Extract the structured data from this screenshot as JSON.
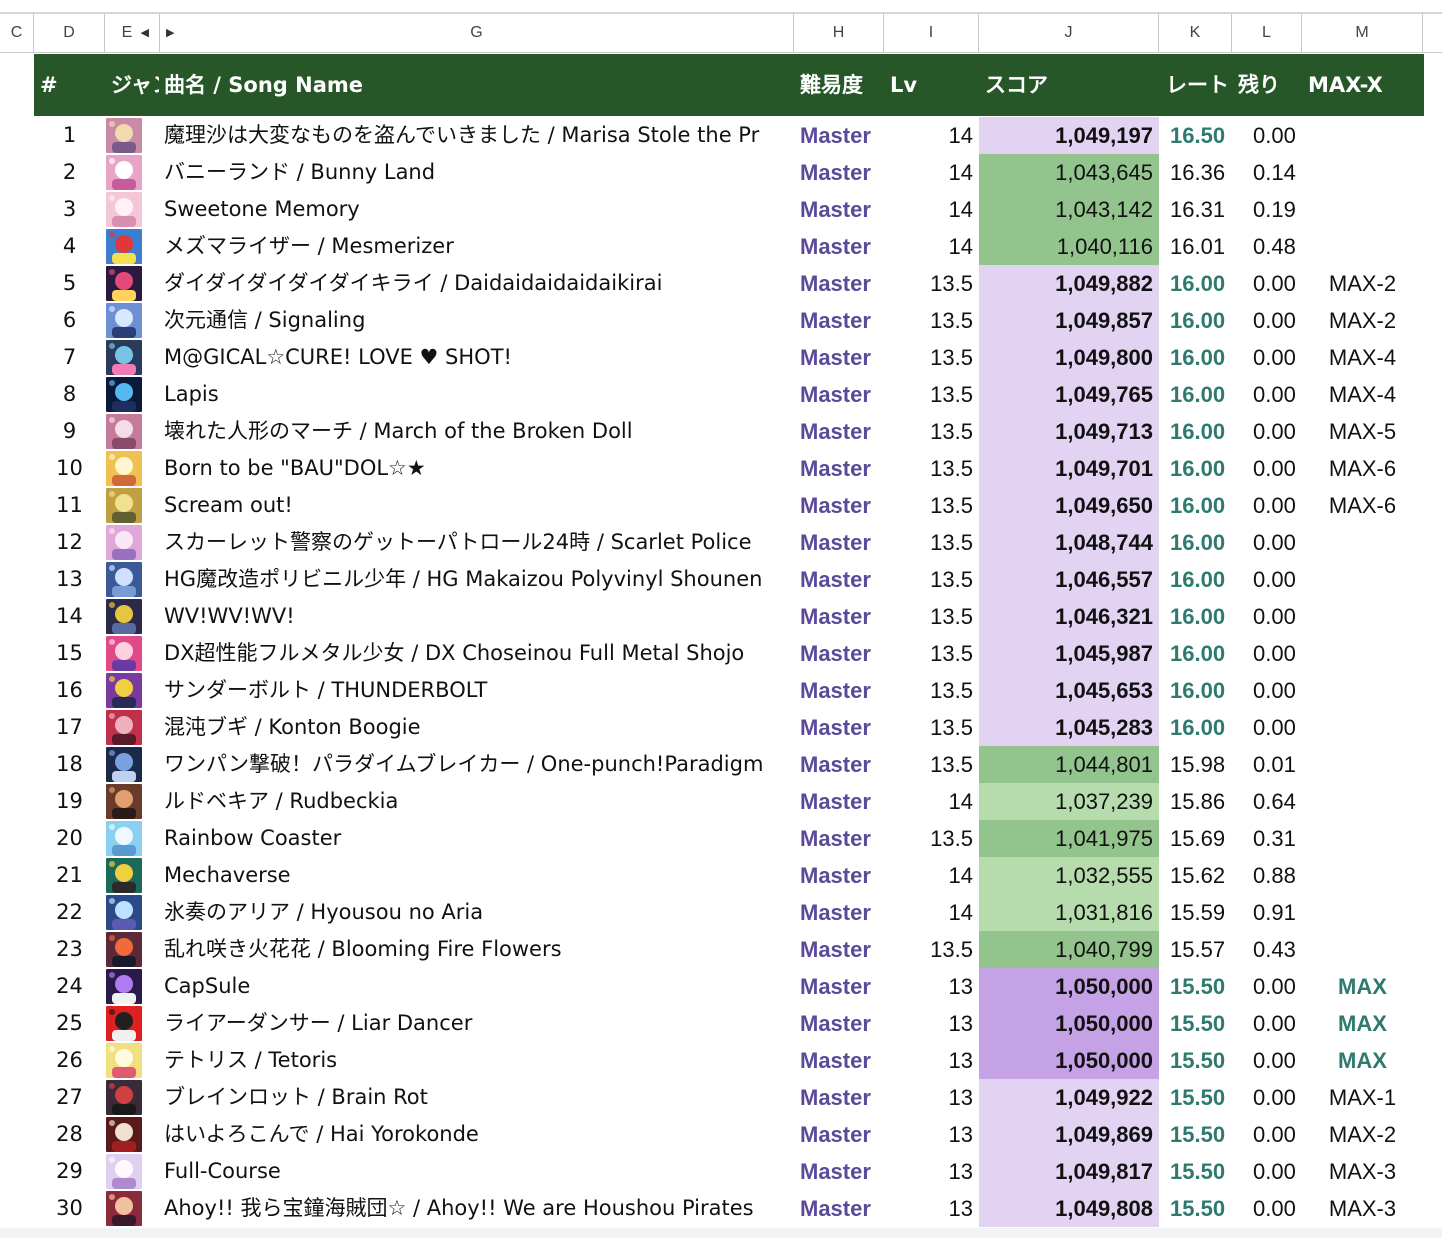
{
  "column_headers": [
    "C",
    "D",
    "E",
    "G",
    "H",
    "I",
    "J",
    "K",
    "L",
    "M"
  ],
  "header": {
    "num": "#",
    "genre": "ジャンル",
    "song": "曲名 / Song Name",
    "difficulty": "難易度",
    "lv": "Lv",
    "score": "スコア",
    "rate": "レート",
    "remaining": "残り",
    "maxx": "MAX-X"
  },
  "colors": {
    "header_bg": "#275729",
    "score_purple": "#e2d3f3",
    "score_purple_max": "#c5a2e6",
    "score_green": "#94c48d",
    "score_green_light": "#b6dcad",
    "difficulty_text": "#5b4a9a",
    "rate_teal": "#2e7a6e"
  },
  "rows": [
    {
      "n": "1",
      "song": "魔理沙は大変なものを盗んでいきました / Marisa Stole the Pr",
      "diff": "Master",
      "lv": "14",
      "score": "1,049,197",
      "rate": "16.50",
      "rem": "0.00",
      "maxx": "",
      "bg": "purple",
      "bold": true,
      "top": true
    },
    {
      "n": "2",
      "song": "バニーランド / Bunny Land",
      "diff": "Master",
      "lv": "14",
      "score": "1,043,645",
      "rate": "16.36",
      "rem": "0.14",
      "maxx": "",
      "bg": "green",
      "bold": false,
      "top": false
    },
    {
      "n": "3",
      "song": "Sweetone Memory",
      "diff": "Master",
      "lv": "14",
      "score": "1,043,142",
      "rate": "16.31",
      "rem": "0.19",
      "maxx": "",
      "bg": "green",
      "bold": false,
      "top": false
    },
    {
      "n": "4",
      "song": "メズマライザー / Mesmerizer",
      "diff": "Master",
      "lv": "14",
      "score": "1,040,116",
      "rate": "16.01",
      "rem": "0.48",
      "maxx": "",
      "bg": "green",
      "bold": false,
      "top": false
    },
    {
      "n": "5",
      "song": "ダイダイダイダイダイキライ / Daidaidaidaidaikirai",
      "diff": "Master",
      "lv": "13.5",
      "score": "1,049,882",
      "rate": "16.00",
      "rem": "0.00",
      "maxx": "MAX-2",
      "bg": "purple",
      "bold": true,
      "top": true
    },
    {
      "n": "6",
      "song": "次元通信 / Signaling",
      "diff": "Master",
      "lv": "13.5",
      "score": "1,049,857",
      "rate": "16.00",
      "rem": "0.00",
      "maxx": "MAX-2",
      "bg": "purple",
      "bold": true,
      "top": true
    },
    {
      "n": "7",
      "song": "M@GICAL☆CURE! LOVE ♥ SHOT!",
      "diff": "Master",
      "lv": "13.5",
      "score": "1,049,800",
      "rate": "16.00",
      "rem": "0.00",
      "maxx": "MAX-4",
      "bg": "purple",
      "bold": true,
      "top": true
    },
    {
      "n": "8",
      "song": "Lapis",
      "diff": "Master",
      "lv": "13.5",
      "score": "1,049,765",
      "rate": "16.00",
      "rem": "0.00",
      "maxx": "MAX-4",
      "bg": "purple",
      "bold": true,
      "top": true
    },
    {
      "n": "9",
      "song": "壊れた人形のマーチ / March of the Broken Doll",
      "diff": "Master",
      "lv": "13.5",
      "score": "1,049,713",
      "rate": "16.00",
      "rem": "0.00",
      "maxx": "MAX-5",
      "bg": "purple",
      "bold": true,
      "top": true
    },
    {
      "n": "10",
      "song": "Born to be \"BAU\"DOL☆★",
      "diff": "Master",
      "lv": "13.5",
      "score": "1,049,701",
      "rate": "16.00",
      "rem": "0.00",
      "maxx": "MAX-6",
      "bg": "purple",
      "bold": true,
      "top": true
    },
    {
      "n": "11",
      "song": "Scream out!",
      "diff": "Master",
      "lv": "13.5",
      "score": "1,049,650",
      "rate": "16.00",
      "rem": "0.00",
      "maxx": "MAX-6",
      "bg": "purple",
      "bold": true,
      "top": true
    },
    {
      "n": "12",
      "song": "スカーレット警察のゲットーパトロール24時 / Scarlet Police",
      "diff": "Master",
      "lv": "13.5",
      "score": "1,048,744",
      "rate": "16.00",
      "rem": "0.00",
      "maxx": "",
      "bg": "purple",
      "bold": true,
      "top": true
    },
    {
      "n": "13",
      "song": "HG魔改造ポリビニル少年 / HG Makaizou Polyvinyl Shounen",
      "diff": "Master",
      "lv": "13.5",
      "score": "1,046,557",
      "rate": "16.00",
      "rem": "0.00",
      "maxx": "",
      "bg": "purple",
      "bold": true,
      "top": true
    },
    {
      "n": "14",
      "song": "WV!WV!WV!",
      "diff": "Master",
      "lv": "13.5",
      "score": "1,046,321",
      "rate": "16.00",
      "rem": "0.00",
      "maxx": "",
      "bg": "purple",
      "bold": true,
      "top": true
    },
    {
      "n": "15",
      "song": "DX超性能フルメタル少女 / DX Choseinou Full Metal Shojo",
      "diff": "Master",
      "lv": "13.5",
      "score": "1,045,987",
      "rate": "16.00",
      "rem": "0.00",
      "maxx": "",
      "bg": "purple",
      "bold": true,
      "top": true
    },
    {
      "n": "16",
      "song": "サンダーボルト / THUNDERBOLT",
      "diff": "Master",
      "lv": "13.5",
      "score": "1,045,653",
      "rate": "16.00",
      "rem": "0.00",
      "maxx": "",
      "bg": "purple",
      "bold": true,
      "top": true
    },
    {
      "n": "17",
      "song": "混沌ブギ / Konton Boogie",
      "diff": "Master",
      "lv": "13.5",
      "score": "1,045,283",
      "rate": "16.00",
      "rem": "0.00",
      "maxx": "",
      "bg": "purple",
      "bold": true,
      "top": true
    },
    {
      "n": "18",
      "song": "ワンパン撃破！パラダイムブレイカー / One-punch!Paradigm",
      "diff": "Master",
      "lv": "13.5",
      "score": "1,044,801",
      "rate": "15.98",
      "rem": "0.01",
      "maxx": "",
      "bg": "green",
      "bold": false,
      "top": false
    },
    {
      "n": "19",
      "song": "ルドベキア / Rudbeckia",
      "diff": "Master",
      "lv": "14",
      "score": "1,037,239",
      "rate": "15.86",
      "rem": "0.64",
      "maxx": "",
      "bg": "greenlight",
      "bold": false,
      "top": false
    },
    {
      "n": "20",
      "song": "Rainbow Coaster",
      "diff": "Master",
      "lv": "13.5",
      "score": "1,041,975",
      "rate": "15.69",
      "rem": "0.31",
      "maxx": "",
      "bg": "green",
      "bold": false,
      "top": false
    },
    {
      "n": "21",
      "song": "Mechaverse",
      "diff": "Master",
      "lv": "14",
      "score": "1,032,555",
      "rate": "15.62",
      "rem": "0.88",
      "maxx": "",
      "bg": "greenlight",
      "bold": false,
      "top": false
    },
    {
      "n": "22",
      "song": "氷奏のアリア / Hyousou no Aria",
      "diff": "Master",
      "lv": "14",
      "score": "1,031,816",
      "rate": "15.59",
      "rem": "0.91",
      "maxx": "",
      "bg": "greenlight",
      "bold": false,
      "top": false
    },
    {
      "n": "23",
      "song": "乱れ咲き火花花 / Blooming Fire Flowers",
      "diff": "Master",
      "lv": "13.5",
      "score": "1,040,799",
      "rate": "15.57",
      "rem": "0.43",
      "maxx": "",
      "bg": "green",
      "bold": false,
      "top": false
    },
    {
      "n": "24",
      "song": "CapSule",
      "diff": "Master",
      "lv": "13",
      "score": "1,050,000",
      "rate": "15.50",
      "rem": "0.00",
      "maxx": "MAX",
      "bg": "purplemax",
      "bold": true,
      "top": true
    },
    {
      "n": "25",
      "song": "ライアーダンサー / Liar Dancer",
      "diff": "Master",
      "lv": "13",
      "score": "1,050,000",
      "rate": "15.50",
      "rem": "0.00",
      "maxx": "MAX",
      "bg": "purplemax",
      "bold": true,
      "top": true
    },
    {
      "n": "26",
      "song": "テトリス / Tetoris",
      "diff": "Master",
      "lv": "13",
      "score": "1,050,000",
      "rate": "15.50",
      "rem": "0.00",
      "maxx": "MAX",
      "bg": "purplemax",
      "bold": true,
      "top": true
    },
    {
      "n": "27",
      "song": "ブレインロット / Brain Rot",
      "diff": "Master",
      "lv": "13",
      "score": "1,049,922",
      "rate": "15.50",
      "rem": "0.00",
      "maxx": "MAX-1",
      "bg": "purple",
      "bold": true,
      "top": true
    },
    {
      "n": "28",
      "song": "はいよろこんで / Hai Yorokonde",
      "diff": "Master",
      "lv": "13",
      "score": "1,049,869",
      "rate": "15.50",
      "rem": "0.00",
      "maxx": "MAX-2",
      "bg": "purple",
      "bold": true,
      "top": true
    },
    {
      "n": "29",
      "song": "Full-Course",
      "diff": "Master",
      "lv": "13",
      "score": "1,049,817",
      "rate": "15.50",
      "rem": "0.00",
      "maxx": "MAX-3",
      "bg": "purple",
      "bold": true,
      "top": true
    },
    {
      "n": "30",
      "song": "Ahoy!! 我ら宝鐘海賊団☆ / Ahoy!! We are Houshou Pirates",
      "diff": "Master",
      "lv": "13",
      "score": "1,049,808",
      "rate": "15.50",
      "rem": "0.00",
      "maxx": "MAX-3",
      "bg": "purple",
      "bold": true,
      "top": true
    }
  ]
}
